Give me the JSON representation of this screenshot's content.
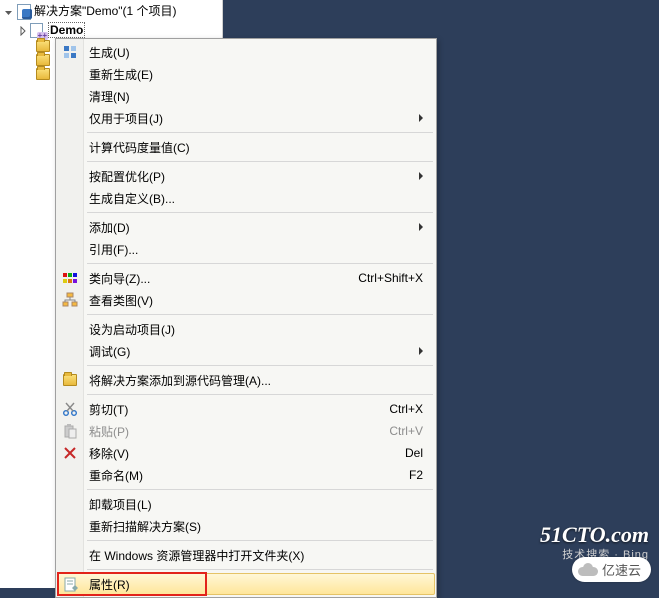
{
  "tree": {
    "solution_label": "解决方案\"Demo\"(1 个项目)",
    "project_label": "Demo"
  },
  "menu": {
    "build": "生成(U)",
    "rebuild": "重新生成(E)",
    "clean": "清理(N)",
    "project_only": "仅用于项目(J)",
    "calc_metrics": "计算代码度量值(C)",
    "pgo": "按配置优化(P)",
    "build_custom": "生成自定义(B)...",
    "add": "添加(D)",
    "references": "引用(F)...",
    "class_wizard": "类向导(Z)...",
    "class_wizard_sc": "Ctrl+Shift+X",
    "view_class": "查看类图(V)",
    "set_startup": "设为启动项目(J)",
    "debug": "调试(G)",
    "add_to_scc": "将解决方案添加到源代码管理(A)...",
    "cut": "剪切(T)",
    "cut_sc": "Ctrl+X",
    "paste": "粘贴(P)",
    "paste_sc": "Ctrl+V",
    "remove": "移除(V)",
    "remove_sc": "Del",
    "rename": "重命名(M)",
    "rename_sc": "F2",
    "unload": "卸载项目(L)",
    "rescan": "重新扫描解决方案(S)",
    "open_explorer": "在 Windows 资源管理器中打开文件夹(X)",
    "properties": "属性(R)"
  },
  "watermarks": {
    "w1": "51CTO.com",
    "w2": "亿速云",
    "w3": "技术搜索 · Bing"
  }
}
